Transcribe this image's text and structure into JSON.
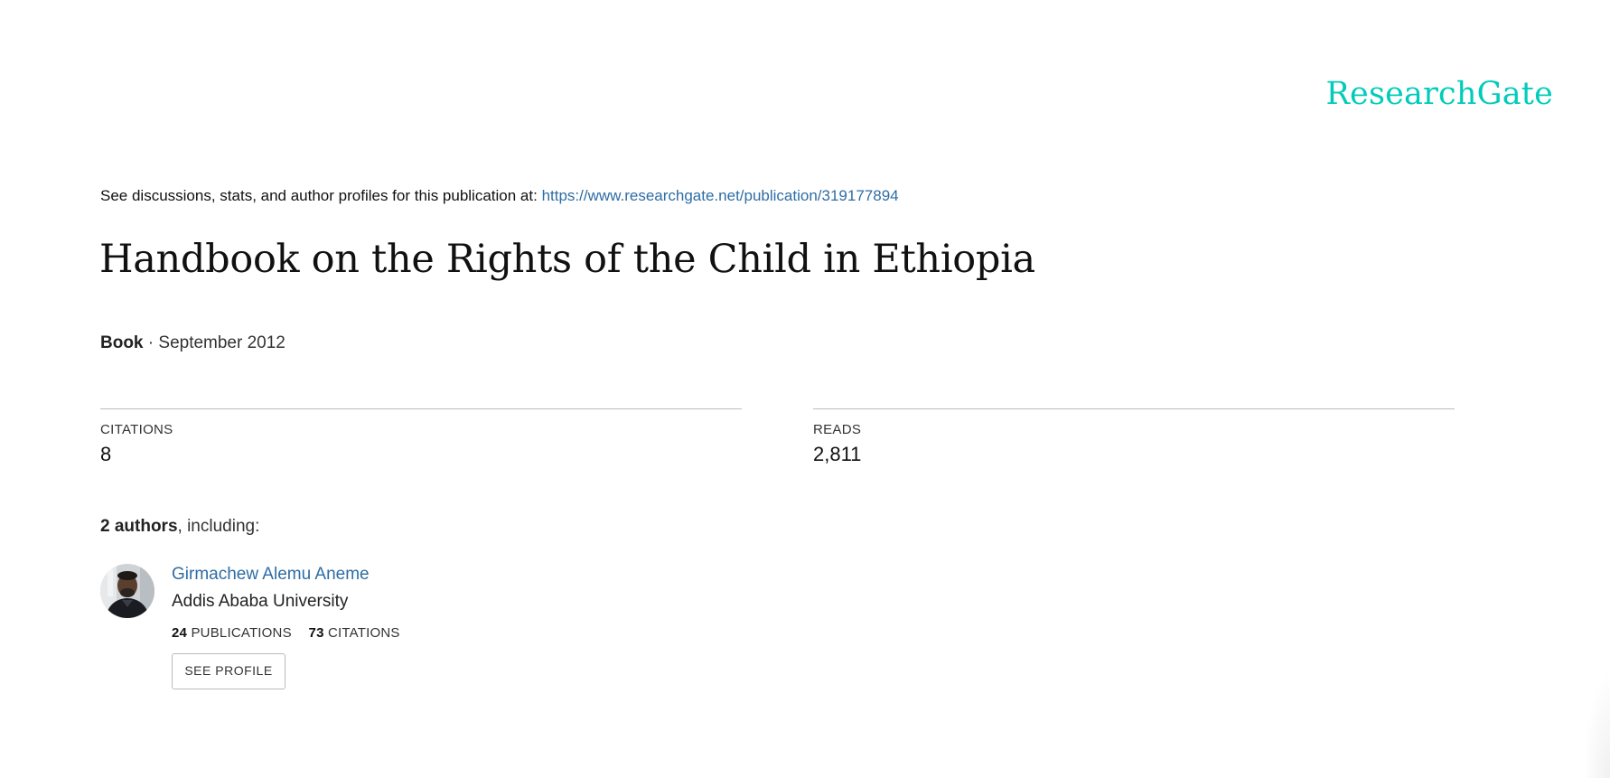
{
  "brand": {
    "logo_text": "ResearchGate",
    "color": "#00ccbb"
  },
  "header": {
    "intro_text": "See discussions, stats, and author profiles for this publication at:",
    "publication_url": "https://www.researchgate.net/publication/319177894"
  },
  "publication": {
    "title": "Handbook on the Rights of the Child in Ethiopia",
    "type": "Book",
    "separator": " · ",
    "date": "September 2012"
  },
  "stats": {
    "citations_label": "CITATIONS",
    "citations_value": "8",
    "reads_label": "READS",
    "reads_value": "2,811"
  },
  "authors": {
    "count_text": "2 authors",
    "suffix_text": ", including:",
    "list": [
      {
        "name": "Girmachew Alemu Aneme",
        "institution": "Addis Ababa University",
        "publications_count": "24",
        "publications_label": "PUBLICATIONS",
        "citations_count": "73",
        "citations_label": "CITATIONS",
        "button_label": "SEE PROFILE"
      }
    ]
  },
  "colors": {
    "link": "#2e6da4",
    "text": "#222222",
    "divider": "#bbbbbb"
  }
}
